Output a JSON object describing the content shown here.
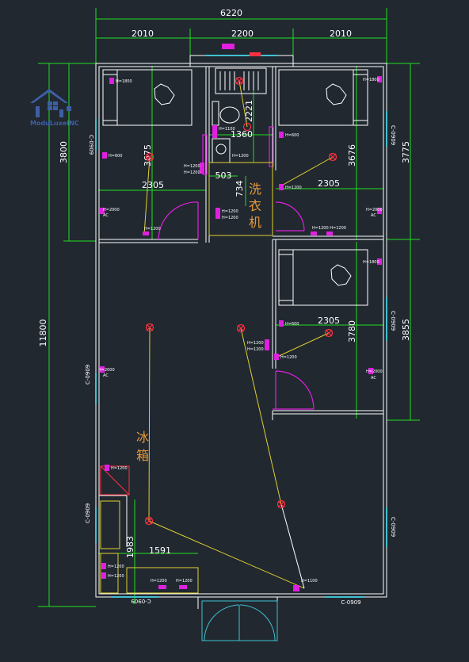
{
  "logo": {
    "text": "ModuLuxeINC",
    "icon": "house-grid-icon",
    "color": "#3d5fa6"
  },
  "dimensions": {
    "overall_width": "6220",
    "top_left": "2010",
    "top_mid": "2200",
    "top_right": "2010",
    "overall_height": "11800",
    "left_bedroom": "3800",
    "right_bedroom_top": "3775",
    "right_bedroom_bottom": "3855",
    "bed1_depth": "3675",
    "bed2_depth": "3676",
    "bed3_depth": "3780",
    "bed1_width": "2305",
    "bed2_width": "2305",
    "bed3_width": "2305",
    "bath_depth": "2221",
    "bath_width": "1360",
    "closet_width": "503",
    "closet_depth": "734",
    "kitchen_height": "1983",
    "kitchen_width": "1591"
  },
  "labels": {
    "washer": "洗衣机",
    "fridge": "冰箱"
  },
  "windows": {
    "left_top": "C-0909",
    "left_mid": "C-0909",
    "left_low": "C-0909",
    "right_top": "C-0909",
    "right_mid": "C-0909",
    "right_low": "C-0909",
    "bottom_left": "C-0909",
    "bottom_right": "C-0909",
    "top_small": "C-0909"
  },
  "outlets": {
    "h1800": "H=1800",
    "h600": "H=600",
    "h1200": "H=1200",
    "h2000": "H=2000",
    "h1100": "H=1100",
    "ac": "AC",
    "h1200h1200": "H=1200 H=1200",
    "h1200x2": "H=1200\nH=1200",
    "h2000ac": "H=2000"
  },
  "colors": {
    "wall": "#ffffff",
    "dim_line": "#20e020",
    "door": "#e020e0",
    "wire": "#e0d030",
    "light": "#ff3040",
    "window": "#40c0d0",
    "furniture": "#ffffff",
    "label_cn": "#e69a3a"
  }
}
